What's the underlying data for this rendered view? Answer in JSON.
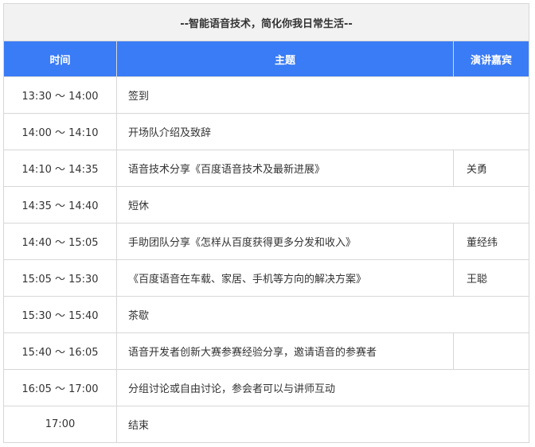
{
  "title": "--智能语音技术，简化你我日常生活--",
  "headers": {
    "time": "时间",
    "topic": "主题",
    "speaker": "演讲嘉宾"
  },
  "rows": [
    {
      "time": "13:30 ～ 14:00",
      "topic": "签到",
      "speaker": null
    },
    {
      "time": "14:00 ～ 14:10",
      "topic": "开场队介绍及致辞",
      "speaker": null
    },
    {
      "time": "14:10 ～ 14:35",
      "topic": "语音技术分享《百度语音技术及最新进展》",
      "speaker": "关勇"
    },
    {
      "time": "14:35 ～ 14:40",
      "topic": "短休",
      "speaker": null
    },
    {
      "time": "14:40 ～ 15:05",
      "topic": "手助团队分享《怎样从百度获得更多分发和收入》",
      "speaker": "董经纬"
    },
    {
      "time": "15:05 ～ 15:30",
      "topic": "《百度语音在车载、家居、手机等方向的解决方案》",
      "speaker": "王聪"
    },
    {
      "time": "15:30 ～ 15:40",
      "topic": "茶歇",
      "speaker": null
    },
    {
      "time": "15:40 ～ 16:05",
      "topic": "语音开发者创新大赛参赛经验分享，邀请语音的参赛者",
      "speaker": ""
    },
    {
      "time": "16:05 ～ 17:00",
      "topic": "分组讨论或自由讨论，参会者可以与讲师互动",
      "speaker": null
    },
    {
      "time": "17:00",
      "topic": "结束",
      "speaker": null
    }
  ]
}
